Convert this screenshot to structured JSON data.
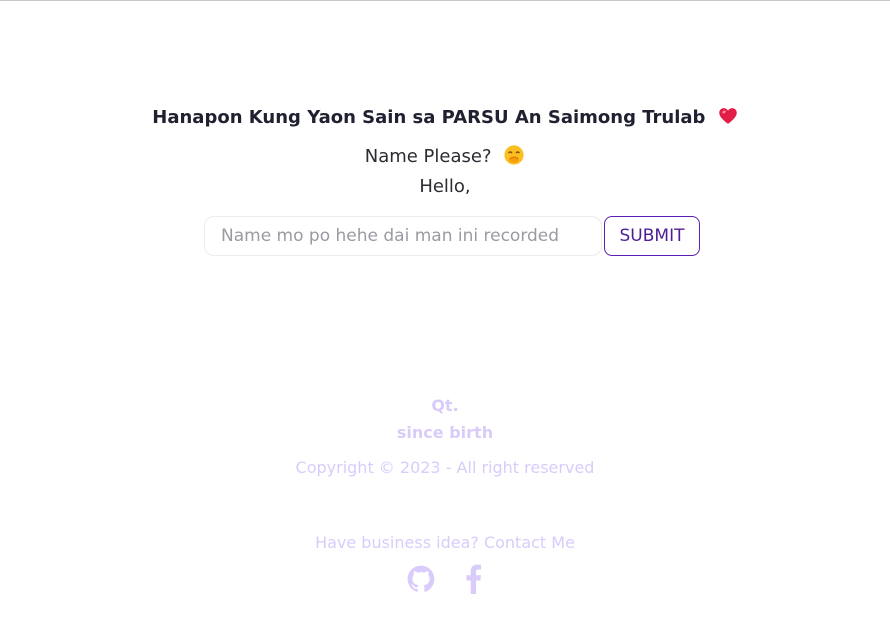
{
  "header": {
    "title": "Hanapon Kung Yaon Sain sa PARSU An Saimong Trulab",
    "title_icon": "heart-emoji",
    "subtitle": "Name Please?",
    "subtitle_icon": "hand-over-mouth-emoji",
    "greeting": "Hello,"
  },
  "form": {
    "name_placeholder": "Name mo po hehe dai man ini recorded",
    "name_value": "",
    "submit_label": "SUBMIT"
  },
  "footer": {
    "brand_line1": "Qt.",
    "brand_line2": "since birth",
    "copyright": "Copyright © 2023 - All right reserved",
    "contact": "Have business idea? Contact Me",
    "social_icons": [
      "github-icon",
      "facebook-icon"
    ]
  },
  "colors": {
    "accent": "#5b21b6",
    "footer_text": "#d9ccfb",
    "heart": "#e11d48"
  }
}
